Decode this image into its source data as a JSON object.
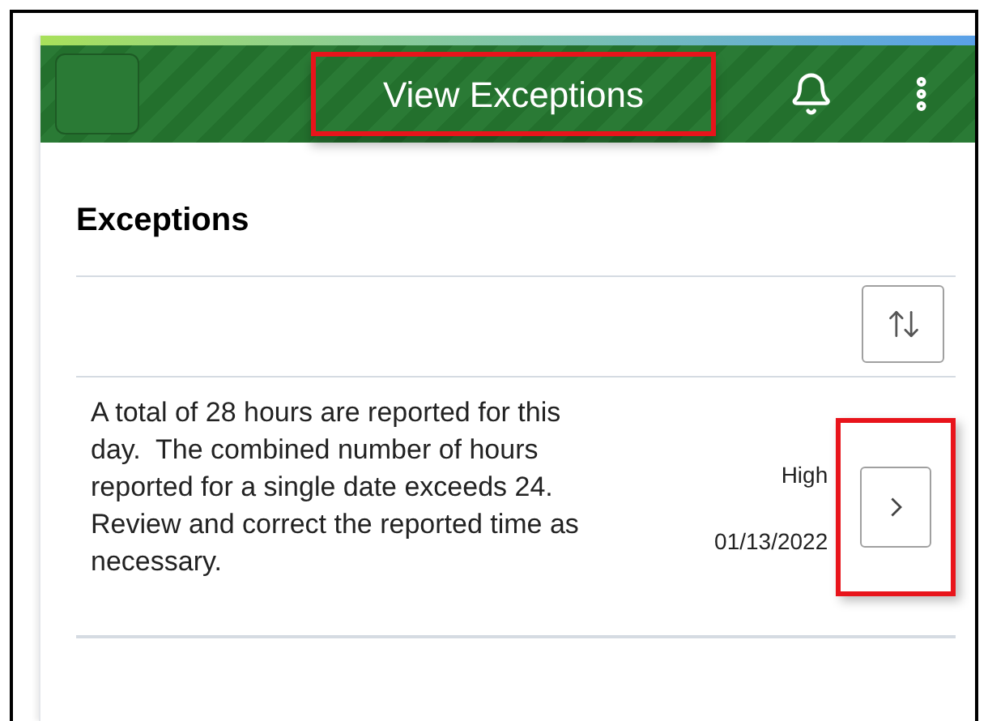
{
  "header": {
    "title": "View Exceptions"
  },
  "section": {
    "title": "Exceptions"
  },
  "exceptions": [
    {
      "message": "A total of 28 hours are reported for this day.  The combined number of hours reported for a single date exceeds 24.   Review and correct the reported time as necessary.",
      "priority": "High",
      "date": "01/13/2022"
    }
  ]
}
